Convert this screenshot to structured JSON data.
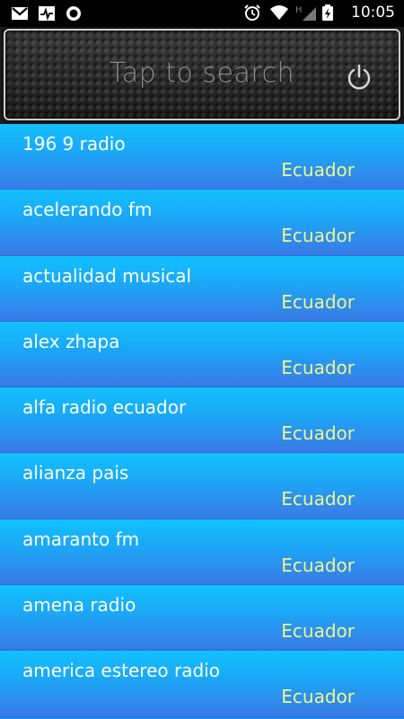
{
  "status_bar": {
    "time": "10:05",
    "left_icons": [
      "gmail-icon",
      "activity-icon",
      "circle-icon"
    ],
    "right_icons": [
      "alarm-icon",
      "wifi-icon",
      "signal-h-icon",
      "battery-charging-icon"
    ]
  },
  "search": {
    "placeholder": "Tap to search",
    "power_icon": "power-icon"
  },
  "colors": {
    "row_top": "#13c1ff",
    "row_bottom": "#3a7ae6",
    "country_text": "#f3f48a"
  },
  "stations": [
    {
      "name": "196 9 radio",
      "country": "Ecuador"
    },
    {
      "name": "acelerando fm",
      "country": "Ecuador"
    },
    {
      "name": "actualidad musical",
      "country": "Ecuador"
    },
    {
      "name": "alex zhapa",
      "country": "Ecuador"
    },
    {
      "name": "alfa radio ecuador",
      "country": "Ecuador"
    },
    {
      "name": "alianza pais",
      "country": "Ecuador"
    },
    {
      "name": "amaranto fm",
      "country": "Ecuador"
    },
    {
      "name": "amena radio",
      "country": "Ecuador"
    },
    {
      "name": "america estereo radio",
      "country": "Ecuador"
    }
  ]
}
